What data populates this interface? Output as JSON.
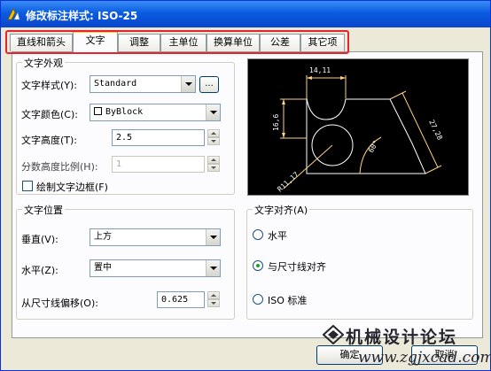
{
  "window": {
    "title": "修改标注样式: ISO-25",
    "accent": "#0a5ce0"
  },
  "tabs": [
    {
      "label": "直线和箭头",
      "active": false
    },
    {
      "label": "文字",
      "active": true
    },
    {
      "label": "调整",
      "active": false
    },
    {
      "label": "主单位",
      "active": false
    },
    {
      "label": "换算单位",
      "active": false
    },
    {
      "label": "公差",
      "active": false
    },
    {
      "label": "其它项",
      "active": false
    }
  ],
  "text_appearance": {
    "title": "文字外观",
    "style_label": "文字样式(Y):",
    "style_value": "Standard",
    "style_browse_label": "...",
    "color_label": "文字颜色(C):",
    "color_value": "ByBlock",
    "height_label": "文字高度(T):",
    "height_value": "2.5",
    "fraction_label": "分数高度比例(H):",
    "fraction_value": "1",
    "frame_label": "绘制文字边框(F)"
  },
  "text_placement": {
    "title": "文字位置",
    "vertical_label": "垂直(V):",
    "vertical_value": "上方",
    "horizontal_label": "水平(Z):",
    "horizontal_value": "置中",
    "offset_label": "从尺寸线偏移(O):",
    "offset_value": "0.625"
  },
  "text_alignment": {
    "title": "文字对齐(A)",
    "options": [
      {
        "label": "水平",
        "selected": false
      },
      {
        "label": "与尺寸线对齐",
        "selected": true
      },
      {
        "label": "ISO 标准",
        "selected": false
      }
    ]
  },
  "preview": {
    "dim_top": "14,11",
    "dim_left": "16,6",
    "dim_right": "27,28",
    "dim_angle": "60°",
    "dim_radius": "R11,17",
    "colors": {
      "geometry": "#ffffff",
      "dimension": "#ffd080",
      "background": "#000000"
    }
  },
  "buttons": {
    "ok": "确定",
    "cancel": "取消"
  },
  "watermark": {
    "text": "机械设计论坛",
    "url": "www.zgjxcad.com"
  }
}
